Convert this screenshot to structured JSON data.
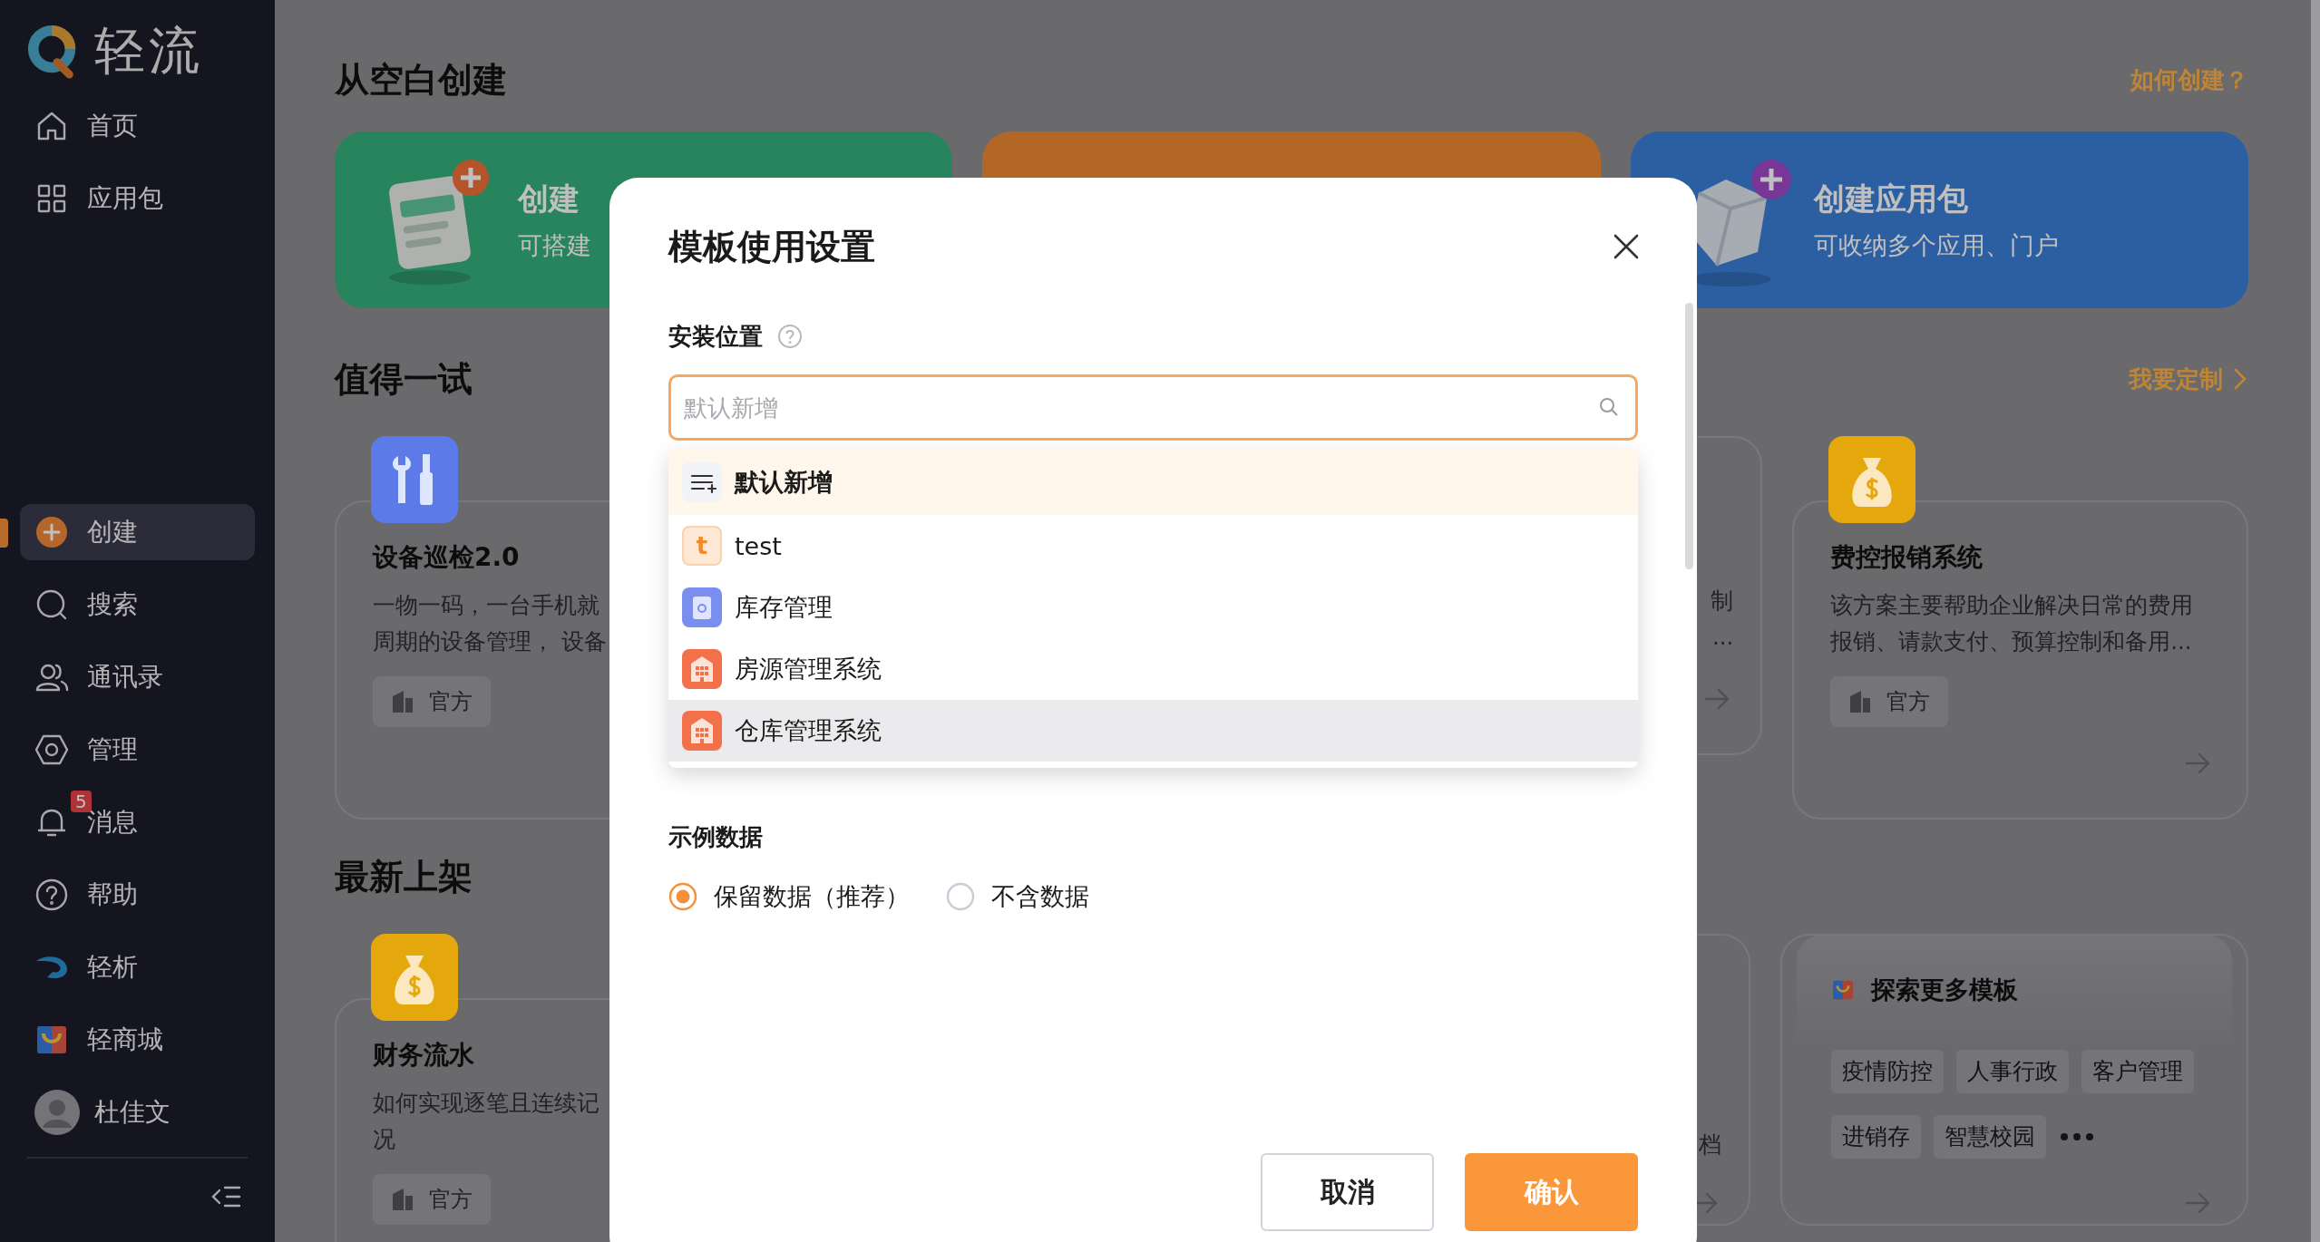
{
  "sidebar": {
    "logo_text": "轻流",
    "top_items": [
      {
        "label": "首页",
        "selected": false
      },
      {
        "label": "应用包",
        "selected": false
      }
    ],
    "items": [
      {
        "label": "创建",
        "selected": true
      },
      {
        "label": "搜索",
        "selected": false
      },
      {
        "label": "通讯录",
        "selected": false
      },
      {
        "label": "管理",
        "selected": false
      },
      {
        "label": "消息",
        "selected": false,
        "badge": "5"
      },
      {
        "label": "帮助",
        "selected": false
      },
      {
        "label": "轻析",
        "selected": false
      },
      {
        "label": "轻商城",
        "selected": false
      }
    ],
    "user": {
      "name": "杜佳文"
    }
  },
  "main": {
    "create_section": {
      "title": "从空白创建",
      "link": "如何创建？",
      "cards": [
        {
          "kind": "form",
          "title": "创建",
          "subtitle": "可搭建"
        },
        {
          "kind": "blank"
        },
        {
          "kind": "cube",
          "title": "创建应用包",
          "subtitle": "可收纳多个应用、门户"
        }
      ]
    },
    "sections": [
      {
        "title": "值得一试",
        "link": "我要定制",
        "cards": [
          {
            "kind": "template",
            "title": "设备巡检2.0",
            "description_lines": [
              "一物一码，一台手机就",
              "周期的设备管理， 设备"
            ],
            "tag": "官方",
            "arrow": false
          },
          {
            "kind": "partial",
            "description_lines": [
              "制",
              "..."
            ],
            "arrow": true
          },
          {
            "kind": "template",
            "title": "费控报销系统",
            "description_lines": [
              "该方案主要帮助企业解决日常的费用",
              "报销、请款支付、预算控制和备用..."
            ],
            "tag": "官方",
            "arrow": true
          }
        ]
      },
      {
        "title": "最新上架",
        "cards": [
          {
            "kind": "template",
            "title": "财务流水",
            "description_lines": [
              "如何实现逐笔且连续记",
              "况"
            ],
            "tag": "官方",
            "arrow": false
          },
          {
            "kind": "partial",
            "description_lines": [
              "档"
            ],
            "arrow": true
          },
          {
            "kind": "explore",
            "title": "探索更多模板",
            "tags": [
              "疫情防控",
              "人事行政",
              "客户管理",
              "进销存",
              "智慧校园"
            ],
            "more": true,
            "arrow": true
          }
        ]
      }
    ]
  },
  "modal": {
    "title": "模板使用设置",
    "field": {
      "label": "安装位置",
      "help": true,
      "placeholder": "默认新增",
      "options": [
        {
          "label": "默认新增",
          "kind": "default",
          "selected": true,
          "hovered": false
        },
        {
          "label": "test",
          "kind": "letter",
          "badge": "t",
          "selected": false,
          "hovered": false
        },
        {
          "label": "库存管理",
          "kind": "clipboard",
          "selected": false,
          "hovered": false
        },
        {
          "label": "房源管理系统",
          "kind": "building",
          "selected": false,
          "hovered": false
        },
        {
          "label": "仓库管理系统",
          "kind": "building",
          "selected": false,
          "hovered": true
        }
      ]
    },
    "sample_data": {
      "label": "示例数据",
      "options": [
        {
          "label": "保留数据（推荐）",
          "selected": true
        },
        {
          "label": "不含数据",
          "selected": false
        }
      ]
    },
    "buttons": [
      {
        "label": "取消",
        "kind": "secondary"
      },
      {
        "label": "确认",
        "kind": "primary"
      }
    ]
  }
}
